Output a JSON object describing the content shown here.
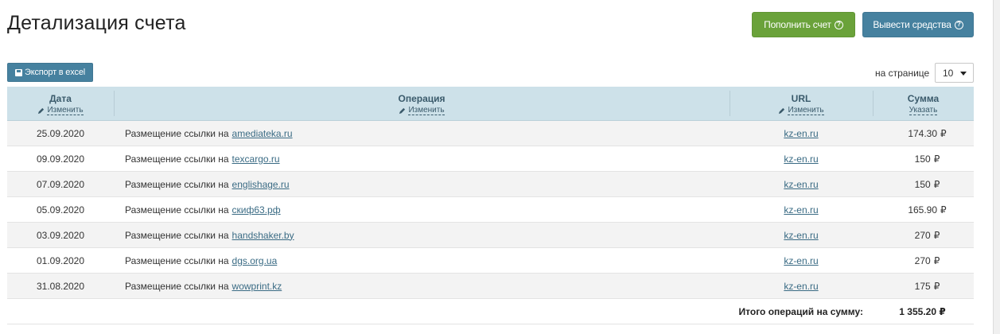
{
  "page": {
    "title": "Детализация счета"
  },
  "actions": {
    "topup_label": "Пополнить счет",
    "withdraw_label": "Вывести средства",
    "export_label": "Экспорт в excel"
  },
  "pagination": {
    "per_page_label": "на странице",
    "per_page_value": "10"
  },
  "table": {
    "columns": [
      {
        "title": "Дата",
        "action": "Изменить"
      },
      {
        "title": "Операция",
        "action": "Изменить"
      },
      {
        "title": "URL",
        "action": "Изменить"
      },
      {
        "title": "Сумма",
        "action": "Указать"
      }
    ],
    "operation_prefix": "Размещение ссылки на",
    "currency": "₽",
    "rows": [
      {
        "date": "25.09.2020",
        "site": "amediateka.ru",
        "url": "kz-en.ru",
        "amount": "174.30"
      },
      {
        "date": "09.09.2020",
        "site": "texcargo.ru",
        "url": "kz-en.ru",
        "amount": "150"
      },
      {
        "date": "07.09.2020",
        "site": "englishage.ru",
        "url": "kz-en.ru",
        "amount": "150"
      },
      {
        "date": "05.09.2020",
        "site": "скиф63.рф",
        "url": "kz-en.ru",
        "amount": "165.90"
      },
      {
        "date": "03.09.2020",
        "site": "handshaker.by",
        "url": "kz-en.ru",
        "amount": "270"
      },
      {
        "date": "01.09.2020",
        "site": "dgs.org.ua",
        "url": "kz-en.ru",
        "amount": "270"
      },
      {
        "date": "31.08.2020",
        "site": "wowprint.kz",
        "url": "kz-en.ru",
        "amount": "175"
      }
    ],
    "total_label": "Итого операций на сумму:",
    "total_value": "1 355.20 ₽"
  },
  "colors": {
    "topup": "#6aa23a",
    "primary": "#46819f",
    "header_bg": "#cde1e9",
    "link": "#3a6b84"
  }
}
